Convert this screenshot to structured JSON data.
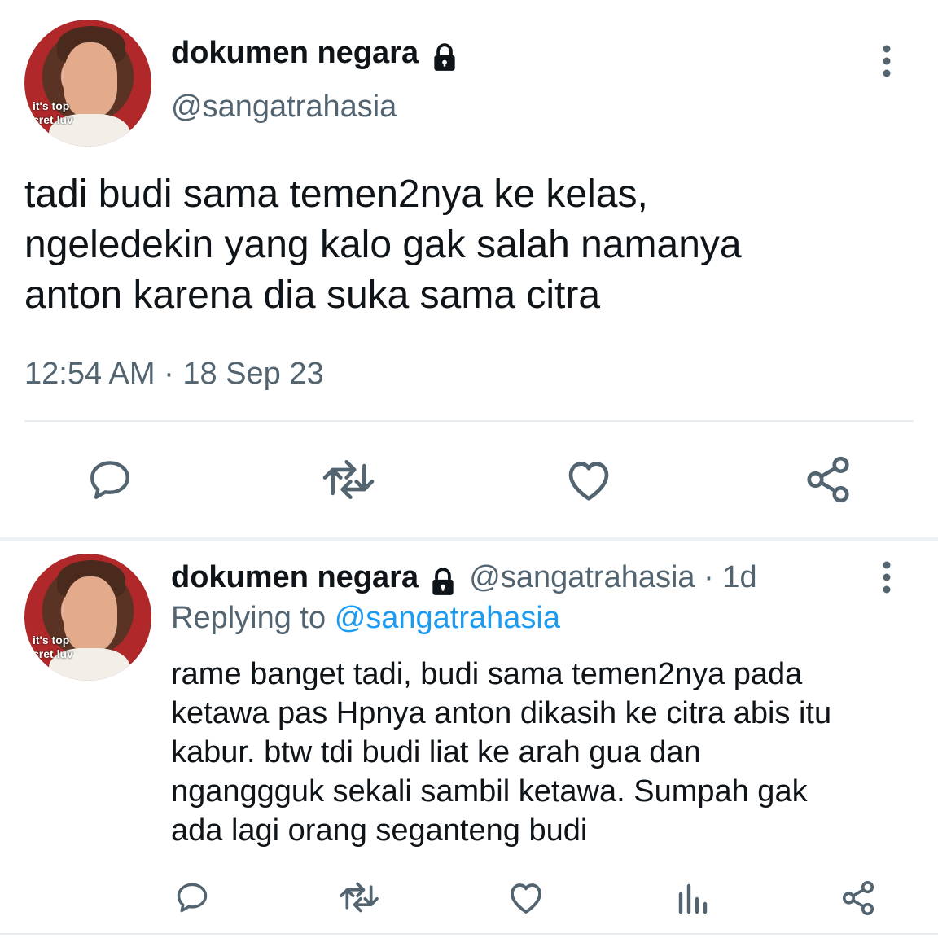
{
  "main_tweet": {
    "display_name": "dokumen negara",
    "handle": "@sangatrahasia",
    "avatar_caption_1": "it's top",
    "avatar_caption_2": "cret luv",
    "text_lines": [
      "tadi budi sama temen2nya ke kelas,",
      "ngeledekin yang kalo gak salah namanya",
      "anton karena dia suka sama citra"
    ],
    "timestamp": "12:54 AM · 18 Sep 23"
  },
  "reply": {
    "display_name": "dokumen negara",
    "handle_time": "@sangatrahasia · 1d",
    "replying_prefix": "Replying to",
    "replying_to": "@sangatrahasia",
    "avatar_caption_1": "it's top",
    "avatar_caption_2": "cret luv",
    "text_lines": [
      "rame banget tadi, budi sama temen2nya pada",
      "ketawa pas Hpnya anton dikasih ke citra abis itu",
      "kabur. btw tdi budi liat ke arah gua dan",
      "nganggguk sekali sambil ketawa. Sumpah gak",
      "ada lagi orang seganteng budi"
    ]
  },
  "colors": {
    "text": "#0f1419",
    "secondary": "#536471",
    "link": "#1d9bf0",
    "divider": "#e6ecf0"
  },
  "icons": [
    "lock-icon",
    "more-icon",
    "reply-icon",
    "retweet-icon",
    "like-icon",
    "share-icon",
    "analytics-icon"
  ]
}
